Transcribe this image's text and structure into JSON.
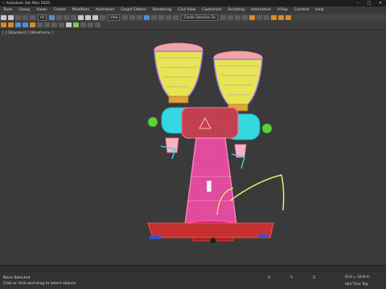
{
  "window": {
    "title": "— Autodesk 3ds Max 2020"
  },
  "menu": {
    "items": [
      "Tools",
      "Group",
      "Views",
      "Create",
      "Modifiers",
      "Animation",
      "Graph Editors",
      "Rendering",
      "Civil View",
      "Customize",
      "Scripting",
      "Interactive",
      "V-Ray",
      "Content",
      "Help"
    ]
  },
  "toolbar": {
    "selection_filter": "All",
    "view_dropdown": "View",
    "named_selection": "Create Selection Se"
  },
  "viewport": {
    "label": "[ ] [Standard ] [Wireframe ]"
  },
  "status": {
    "selection": "None Selected",
    "prompt": "Click or click-and-drag to select objects",
    "x_label": "X:",
    "y_label": "Y:",
    "z_label": "Z:",
    "grid": "Grid = 10,0cm",
    "add_time_tag": "Add Time Tag"
  },
  "colors": {
    "wire_pink": "#ff5fa0",
    "wire_cyan": "#35e0e8",
    "wire_yellow": "#e8e84a",
    "wire_green": "#6de04a",
    "wire_red": "#c42a2a",
    "bg": "#3a3a3a"
  }
}
